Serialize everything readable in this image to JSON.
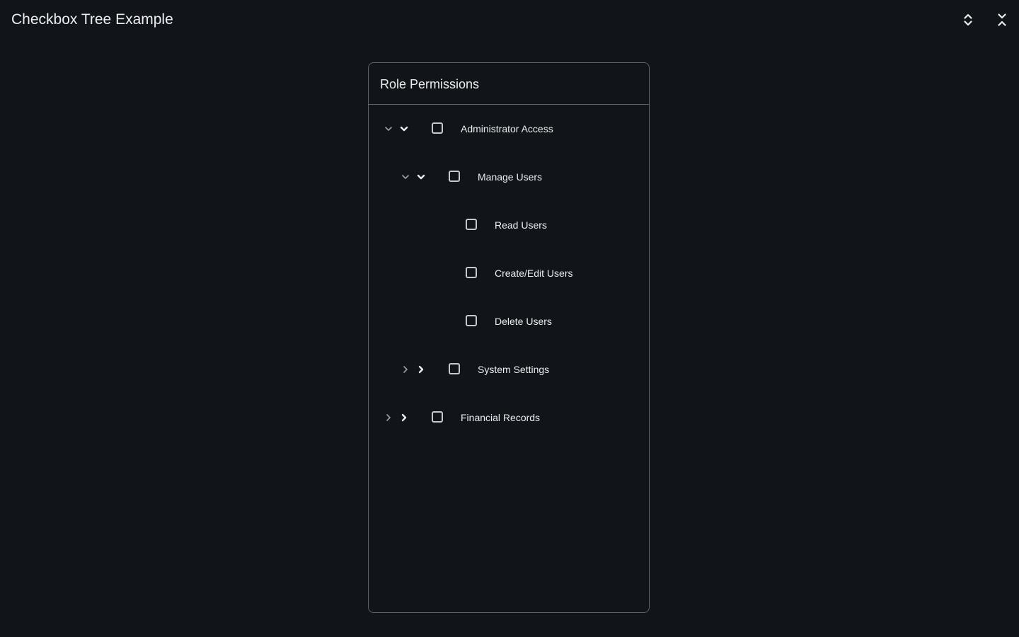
{
  "app": {
    "title": "Checkbox Tree Example",
    "actions": [
      {
        "id": "expand-all",
        "icon": "unfold-more-icon"
      },
      {
        "id": "collapse-all",
        "icon": "unfold-less-icon"
      }
    ]
  },
  "panel": {
    "title": "Role Permissions"
  },
  "tree": {
    "nodes": [
      {
        "label": "Administrator Access",
        "level": 0,
        "expandable": true,
        "expanded": true,
        "checked": false
      },
      {
        "label": "Manage Users",
        "level": 1,
        "expandable": true,
        "expanded": true,
        "checked": false
      },
      {
        "label": "Read Users",
        "level": 2,
        "expandable": false,
        "expanded": false,
        "checked": false
      },
      {
        "label": "Create/Edit Users",
        "level": 2,
        "expandable": false,
        "expanded": false,
        "checked": false
      },
      {
        "label": "Delete Users",
        "level": 2,
        "expandable": false,
        "expanded": false,
        "checked": false
      },
      {
        "label": "System Settings",
        "level": 1,
        "expandable": true,
        "expanded": false,
        "checked": false
      },
      {
        "label": "Financial Records",
        "level": 0,
        "expandable": true,
        "expanded": false,
        "checked": false
      }
    ]
  },
  "colors": {
    "background": "#111418",
    "border": "#5f6368",
    "text": "#eceef0",
    "muted_icon": "#9aa0a6"
  }
}
